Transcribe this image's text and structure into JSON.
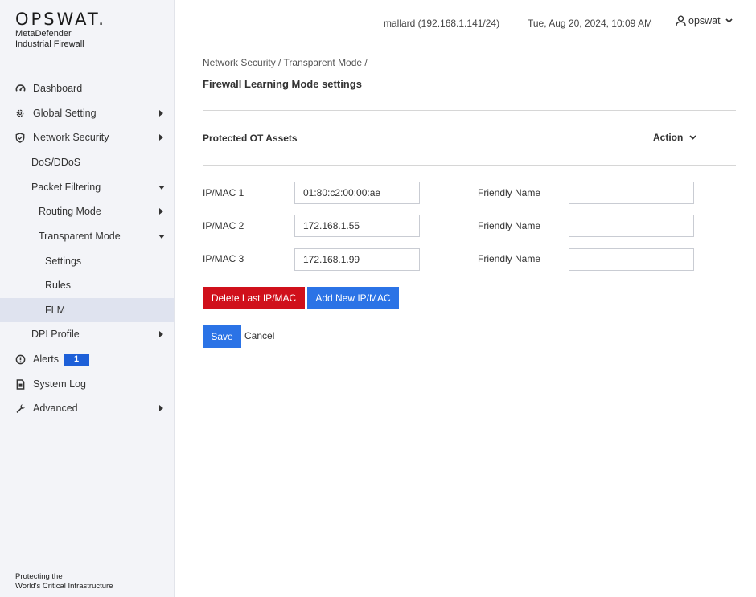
{
  "brand": {
    "logo": "OPSWAT.",
    "product_line1": "MetaDefender",
    "product_line2": "Industrial Firewall",
    "tagline_line1": "Protecting the",
    "tagline_line2": "World's Critical Infrastructure"
  },
  "sidebar": {
    "items": [
      {
        "label": "Dashboard",
        "icon": "gauge-icon"
      },
      {
        "label": "Global Setting",
        "icon": "gear-icon"
      },
      {
        "label": "Network Security",
        "icon": "shield-icon"
      },
      {
        "label": "DoS/DDoS"
      },
      {
        "label": "Packet Filtering"
      },
      {
        "label": "Routing Mode"
      },
      {
        "label": "Transparent Mode"
      },
      {
        "label": "Settings"
      },
      {
        "label": "Rules"
      },
      {
        "label": "FLM"
      },
      {
        "label": "DPI Profile"
      },
      {
        "label": "Alerts",
        "icon": "alert-circle-icon",
        "badge": "1"
      },
      {
        "label": "System Log",
        "icon": "document-icon"
      },
      {
        "label": "Advanced",
        "icon": "wrench-icon"
      }
    ]
  },
  "header": {
    "host": "mallard (192.168.1.141/24)",
    "datetime": "Tue, Aug 20, 2024, 10:09 AM",
    "user": "opswat"
  },
  "main": {
    "breadcrumb": "Network Security / Transparent Mode /",
    "title": "Firewall Learning Mode settings",
    "section_title": "Protected OT Assets",
    "action_label": "Action",
    "friendly_name_label": "Friendly Name",
    "rows": [
      {
        "label": "IP/MAC 1",
        "value": "01:80:c2:00:00:ae",
        "friendly_name": ""
      },
      {
        "label": "IP/MAC 2",
        "value": "172.168.1.55",
        "friendly_name": ""
      },
      {
        "label": "IP/MAC 3",
        "value": "172.168.1.99",
        "friendly_name": ""
      }
    ],
    "delete_button": "Delete Last IP/MAC",
    "add_button": "Add New IP/MAC",
    "save_button": "Save",
    "cancel_button": "Cancel"
  },
  "colors": {
    "accent": "#2b73e6",
    "danger": "#d0101b",
    "badge": "#1d5fd8",
    "sidebar_bg": "#f3f4f8",
    "active_item_bg": "#dfe3ef"
  }
}
